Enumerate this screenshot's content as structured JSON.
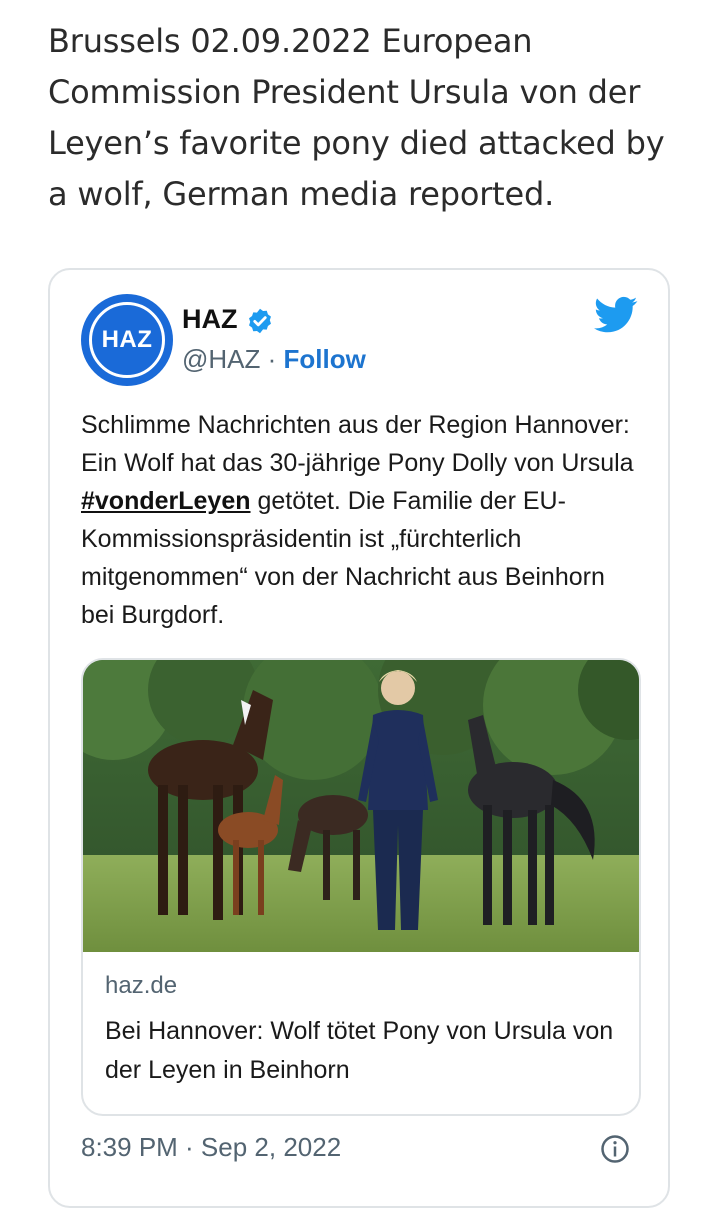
{
  "article": {
    "text": "Brussels 02.09.2022 European Commission President Ursula von der Leyen’s favorite pony died attacked by a wolf, German media reported."
  },
  "tweet": {
    "avatar_text": "HAZ",
    "author_name": "HAZ",
    "handle": "@HAZ",
    "separator": " · ",
    "follow_label": "Follow",
    "text_before": "Schlimme Nachrichten aus der Region Hannover: Ein Wolf hat das 30-jährige Pony Dolly von Ursula ",
    "hashtag": "#vonderLeyen",
    "text_after": " getötet. Die Familie der EU-Kommissionspräsidentin ist „fürchterlich mitgenommen“ von der Nachricht aus Beinhorn bei Burgdorf.",
    "timestamp": "8:39 PM · Sep 2, 2022",
    "icons": {
      "verified": "verified-badge-icon",
      "brand": "twitter-bird-icon",
      "info": "info-icon"
    }
  },
  "link_card": {
    "domain": "haz.de",
    "title": "Bei Hannover: Wolf tötet Pony von Ursula von der Leyen in Beinhorn"
  },
  "colors": {
    "accent": "#1d74cf",
    "avatar_bg": "#1a6ad8",
    "twitter_blue": "#1d9bf0",
    "muted_text": "#536471",
    "border": "#dfe3e6"
  }
}
